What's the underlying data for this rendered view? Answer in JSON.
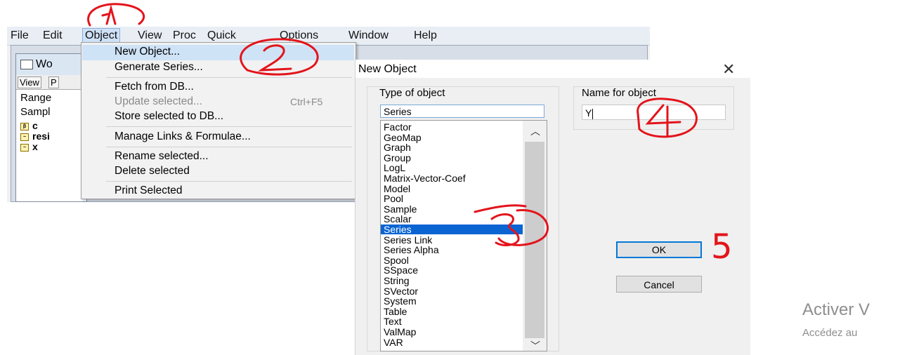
{
  "menubar": {
    "items": [
      "File",
      "Edit",
      "Object",
      "View",
      "Proc",
      "Quick",
      "Options",
      "Window",
      "Help"
    ],
    "active": "Object"
  },
  "workfile": {
    "title": "Wo",
    "toolbar": [
      "View",
      "P"
    ],
    "range_label": "Range",
    "sample_label": "Sampl",
    "objects": [
      {
        "name": "c",
        "icon": "coef-icon"
      },
      {
        "name": "resi",
        "icon": "series-icon"
      },
      {
        "name": "x",
        "icon": "series-icon"
      }
    ]
  },
  "object_menu": {
    "items": [
      {
        "label": "New Object...",
        "highlighted": true
      },
      {
        "label": "Generate Series..."
      },
      {
        "label": "Fetch from DB..."
      },
      {
        "label": "Update selected...",
        "shortcut": "Ctrl+F5",
        "disabled": true
      },
      {
        "label": "Store selected to DB..."
      },
      {
        "label": "Manage Links & Formulae..."
      },
      {
        "label": "Rename selected..."
      },
      {
        "label": "Delete selected"
      },
      {
        "label": "Print Selected"
      }
    ]
  },
  "dialog": {
    "title": "New Object",
    "close_glyph": "✕",
    "type_label": "Type of object",
    "type_value": "Series",
    "type_options": [
      "Factor",
      "GeoMap",
      "Graph",
      "Group",
      "LogL",
      "Matrix-Vector-Coef",
      "Model",
      "Pool",
      "Sample",
      "Scalar",
      "Series",
      "Series Link",
      "Series Alpha",
      "Spool",
      "SSpace",
      "String",
      "SVector",
      "System",
      "Table",
      "Text",
      "ValMap",
      "VAR"
    ],
    "selected_type": "Series",
    "name_label": "Name for object",
    "name_value": "Y",
    "ok_label": "OK",
    "cancel_label": "Cancel"
  },
  "watermark": {
    "line1": "Activer V",
    "line2": "Accédez au"
  },
  "annotations": {
    "step5": "5"
  },
  "colors": {
    "annotation": "#e3141b",
    "selection": "#0a64d2",
    "menu_highlight": "#cfe3f7"
  }
}
